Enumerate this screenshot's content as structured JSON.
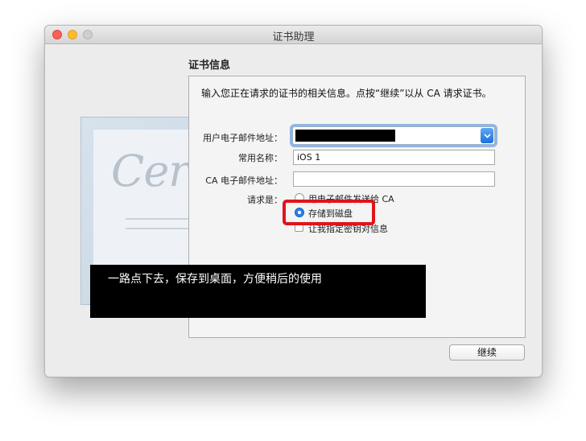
{
  "window": {
    "title": "证书助理"
  },
  "section": {
    "heading": "证书信息"
  },
  "panel": {
    "description": "输入您正在请求的证书的相关信息。点按“继续”以从 CA 请求证书。",
    "fields": {
      "user_email_label": "用户电子邮件地址：",
      "common_name_label": "常用名称：",
      "common_name_value": "iOS 1",
      "ca_email_label": "CA 电子邮件地址：",
      "ca_email_value": "",
      "request_label": "请求是："
    },
    "options": {
      "email_to_ca": "用电子邮件发送给 CA",
      "save_to_disk": "存储到磁盘",
      "specify_key_pair": "让我指定密钥对信息"
    }
  },
  "buttons": {
    "continue_label": "继续"
  },
  "overlay": {
    "caption": "一路点下去，保存到桌面，方便稍后的使用"
  },
  "illustration": {
    "script_text": "Certificate"
  },
  "colors": {
    "highlight": "#e0141a",
    "accent": "#2a7fe8"
  }
}
